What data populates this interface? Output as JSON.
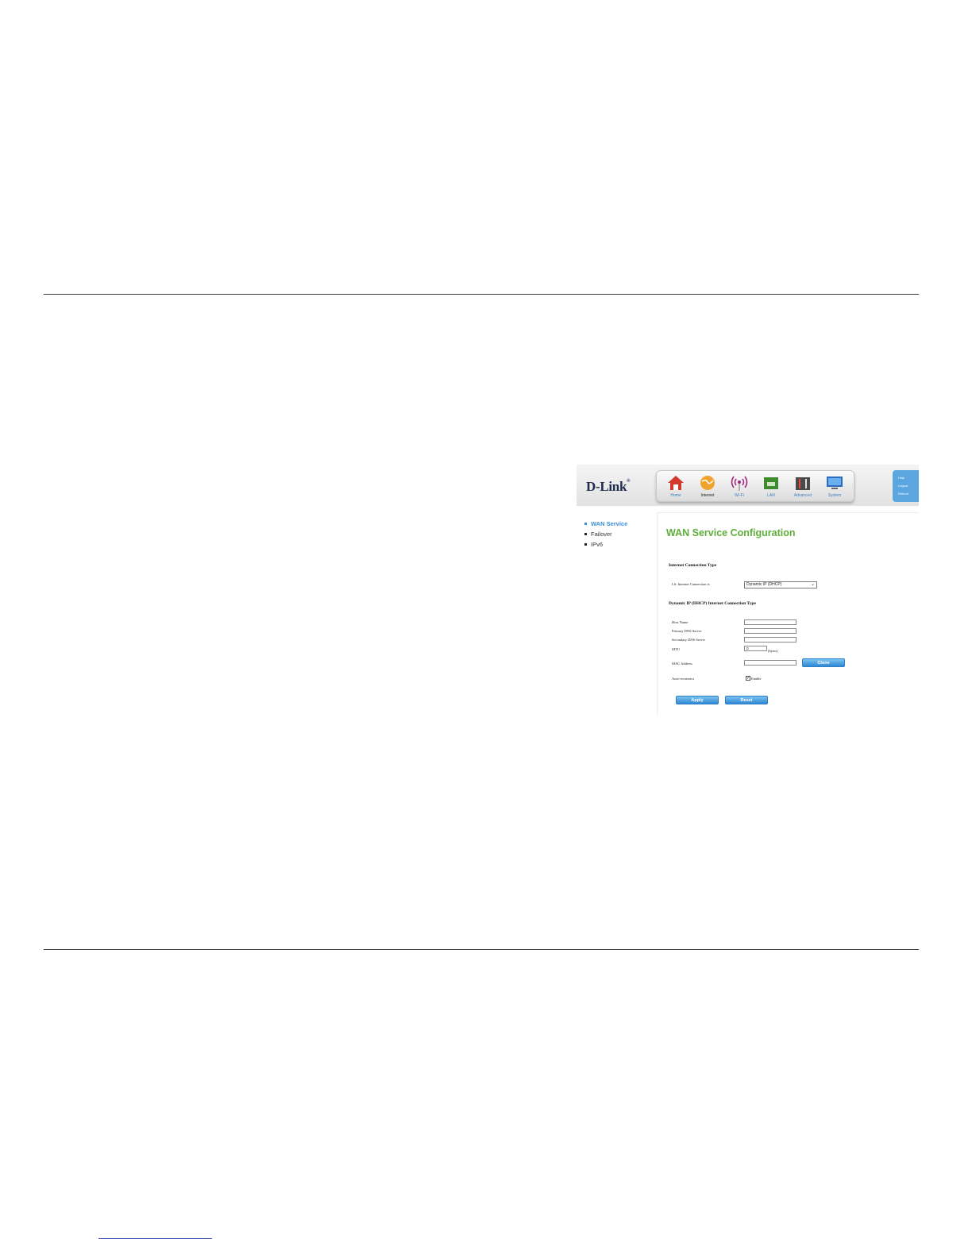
{
  "screenshot": {
    "logo": "D-Link",
    "nav": [
      {
        "label": "Home",
        "icon": "home-icon"
      },
      {
        "label": "Internet",
        "icon": "globe-icon"
      },
      {
        "label": "Wi-Fi",
        "icon": "wifi-antenna-icon"
      },
      {
        "label": "LAN",
        "icon": "lan-icon"
      },
      {
        "label": "Advanced",
        "icon": "advanced-tools-icon"
      },
      {
        "label": "System",
        "icon": "monitor-icon"
      }
    ],
    "side_panel": [
      "Help",
      "Logout",
      "Reboot"
    ],
    "sidemenu": [
      "WAN Service",
      "Failover",
      "IPv6"
    ],
    "title": "WAN Service Configuration",
    "section1": "Internet Connection Type",
    "connection_label": "LS: Internet Connection is",
    "connection_value": "Dynamic IP (DHCP)",
    "section2": "Dynamic IP (DHCP) Internet Connection Type",
    "fields": {
      "host_name": "Host Name",
      "primary_dns": "Primary DNS Server",
      "secondary_dns": "Secondary DNS Server",
      "mtu": "MTU",
      "mtu_value": "0",
      "mtu_unit": "(bytes)",
      "mac": "MAC Address",
      "auto_reconnect": "Auto-reconnect",
      "enable": "Enable"
    },
    "buttons": {
      "clone": "Clone",
      "apply": "Apply",
      "reset": "Reset"
    }
  },
  "colors": {
    "title_green": "#5fae3a",
    "accent_blue": "#3a8fd6"
  }
}
